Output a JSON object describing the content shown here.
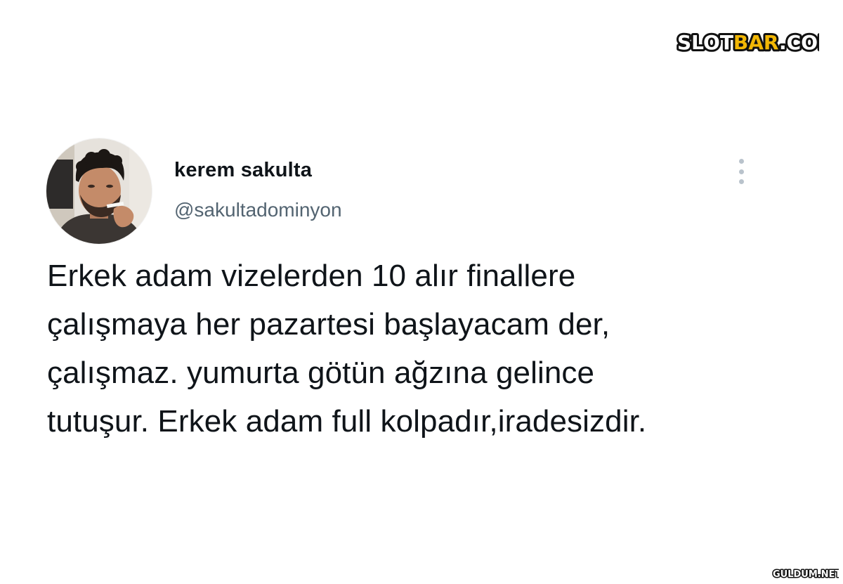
{
  "watermark": {
    "brand_prefix": "SLOT",
    "brand_highlight": "BAR",
    "brand_suffix": ".COM",
    "bottom_text": "GULDUM.NET",
    "colors": {
      "dark": "#111111",
      "highlight": "#f2b705",
      "outline": "#ffffff"
    }
  },
  "tweet": {
    "author": {
      "display_name": "kerem sakulta",
      "handle": "@sakultadominyon",
      "avatar_icon": "profile-photo"
    },
    "more_icon": "vertical-ellipsis-icon",
    "text_lines": [
      "Erkek adam vizelerden 10 alır finallere",
      "çalışmaya her pazartesi başlayacam der,",
      "çalışmaz. yumurta götün ağzına gelince",
      "tutuşur. Erkek adam full kolpadır,iradesizdir."
    ]
  },
  "colors": {
    "text_primary": "#0f1419",
    "text_secondary": "#536471",
    "icon_muted": "#b9c3cc"
  }
}
